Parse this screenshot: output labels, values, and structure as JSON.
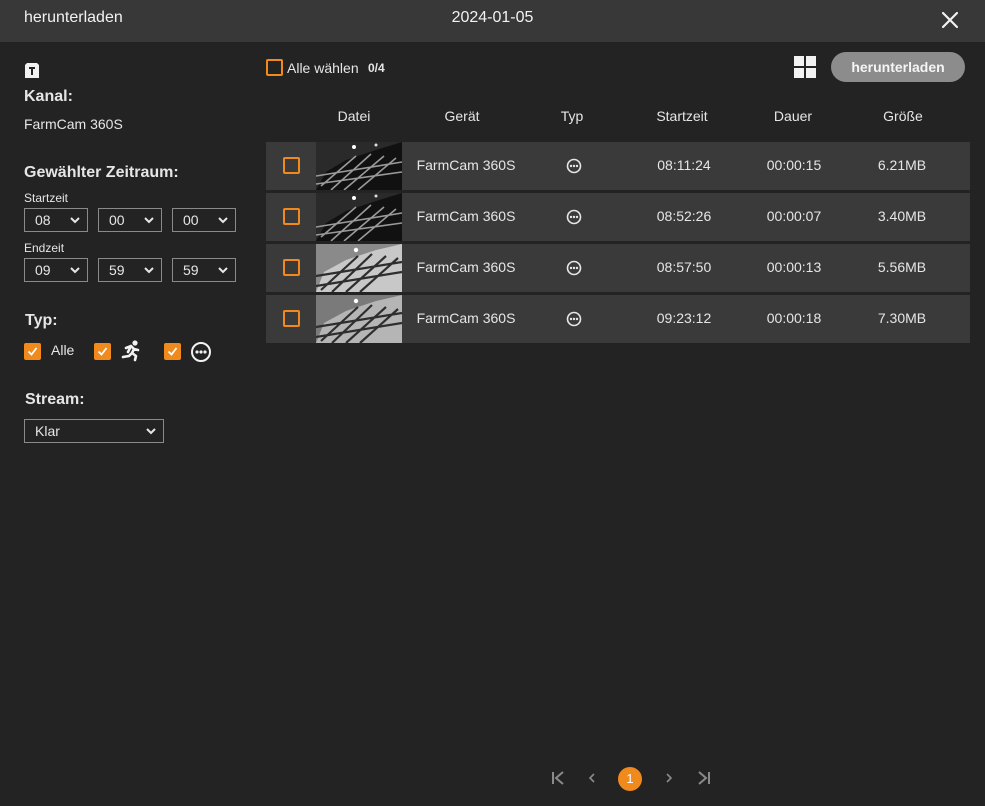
{
  "header": {
    "title": "herunterladen",
    "date": "2024-01-05"
  },
  "left": {
    "channel_label": "Kanal:",
    "channel_value": "FarmCam 360S",
    "range_label": "Gewählter Zeitraum:",
    "start_label": "Startzeit",
    "start": {
      "h": "08",
      "m": "00",
      "s": "00"
    },
    "end_label": "Endzeit",
    "end": {
      "h": "09",
      "m": "59",
      "s": "59"
    },
    "type_label": "Typ:",
    "type_all": "Alle",
    "stream_label": "Stream:",
    "stream_value": "Klar"
  },
  "toolbar": {
    "select_all": "Alle wählen",
    "count": "0/4",
    "download": "herunterladen"
  },
  "table": {
    "headers": {
      "file": "Datei",
      "device": "Gerät",
      "type": "Typ",
      "start": "Startzeit",
      "duration": "Dauer",
      "size": "Größe"
    },
    "rows": [
      {
        "device": "FarmCam 360S",
        "start": "08:11:24",
        "duration": "00:00:15",
        "size": "6.21MB"
      },
      {
        "device": "FarmCam 360S",
        "start": "08:52:26",
        "duration": "00:00:07",
        "size": "3.40MB"
      },
      {
        "device": "FarmCam 360S",
        "start": "08:57:50",
        "duration": "00:00:13",
        "size": "5.56MB"
      },
      {
        "device": "FarmCam 360S",
        "start": "09:23:12",
        "duration": "00:00:18",
        "size": "7.30MB"
      }
    ]
  },
  "pagination": {
    "current": "1"
  },
  "colors": {
    "accent": "#f08a1c",
    "row_bg": "#3a3a3a",
    "header_bg": "#383838",
    "bg": "#232323"
  }
}
